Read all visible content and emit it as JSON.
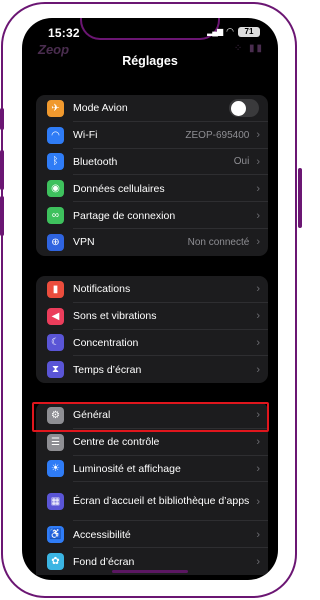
{
  "status_bar": {
    "time": "15:32",
    "battery": "71",
    "brand": "Zeop"
  },
  "nav": {
    "title": "Réglages"
  },
  "colors": {
    "frame": "#6b1673",
    "highlight": "#e0161d",
    "background": "#000000"
  },
  "groups": [
    {
      "items": [
        {
          "label": "Mode Avion",
          "icon": "airplane-icon",
          "icon_color": "#f0992e",
          "value": "",
          "toggle": "off"
        },
        {
          "label": "Wi-Fi",
          "icon": "wifi-icon",
          "icon_color": "#2f7cf6",
          "value": "ZEOP-695400"
        },
        {
          "label": "Bluetooth",
          "icon": "bluetooth-icon",
          "icon_color": "#2f7cf6",
          "value": "Oui"
        },
        {
          "label": "Données cellulaires",
          "icon": "antenna-icon",
          "icon_color": "#3ec15d",
          "value": ""
        },
        {
          "label": "Partage de connexion",
          "icon": "link-icon",
          "icon_color": "#3ec15d",
          "value": ""
        },
        {
          "label": "VPN",
          "icon": "globe-icon",
          "icon_color": "#2f64e0",
          "value": "Non connecté"
        }
      ]
    },
    {
      "items": [
        {
          "label": "Notifications",
          "icon": "bell-icon",
          "icon_color": "#eb4d3d"
        },
        {
          "label": "Sons et vibrations",
          "icon": "speaker-icon",
          "icon_color": "#eb3d5b"
        },
        {
          "label": "Concentration",
          "icon": "moon-icon",
          "icon_color": "#5a55d6"
        },
        {
          "label": "Temps d’écran",
          "icon": "hourglass-icon",
          "icon_color": "#5a55d6"
        }
      ]
    },
    {
      "items": [
        {
          "label": "Général",
          "icon": "gear-icon",
          "icon_color": "#8e8e93"
        },
        {
          "label": "Centre de contrôle",
          "icon": "sliders-icon",
          "icon_color": "#8e8e93"
        },
        {
          "label": "Luminosité et affichage",
          "icon": "sun-icon",
          "icon_color": "#2f7cf6"
        },
        {
          "label": "Écran d’accueil et bibliothèque d’apps",
          "icon": "grid-icon",
          "icon_color": "#5a55d6"
        },
        {
          "label": "Accessibilité",
          "icon": "accessibility-icon",
          "icon_color": "#2f7cf6"
        },
        {
          "label": "Fond d’écran",
          "icon": "flower-icon",
          "icon_color": "#3bb5e3"
        }
      ]
    }
  ]
}
